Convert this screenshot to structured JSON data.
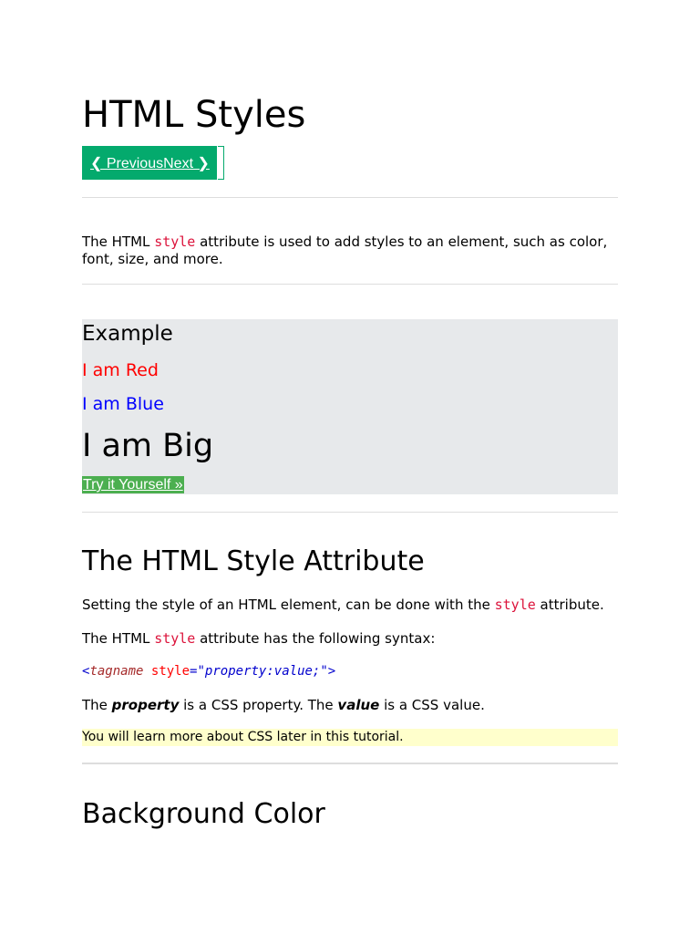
{
  "page": {
    "title": "HTML Styles"
  },
  "nav": {
    "previous_label": "❮ Previous",
    "next_label": "Next ❯"
  },
  "intro": {
    "before": "The HTML ",
    "keyword": "style",
    "after": " attribute is used to add styles to an element, such as color, font, size, and more."
  },
  "example": {
    "title": "Example",
    "red_text": "I am Red",
    "blue_text": "I am Blue",
    "big_text": "I am Big",
    "try_button": "Try it Yourself »",
    "colors": {
      "background": "#e7e9eb",
      "red": "#ff0000",
      "blue": "#0000ff",
      "button": "#4CAF50"
    }
  },
  "style_attribute": {
    "heading": "The HTML Style Attribute",
    "p1_before": "Setting the style of an HTML element, can be done with the ",
    "p1_keyword": "style",
    "p1_after": " attribute.",
    "p2_before": "The HTML ",
    "p2_keyword": "style",
    "p2_after": " attribute has the following syntax:",
    "syntax": {
      "open": "<",
      "tag": "tagname",
      "space": " ",
      "attr": "style",
      "equals": "=",
      "quote_open": "\"",
      "value": "property:value;",
      "quote_close": "\"",
      "close": ">"
    },
    "p3_before": "The ",
    "p3_term1": "property",
    "p3_middle": " is a CSS property. The ",
    "p3_term2": "value",
    "p3_after": " is a CSS value.",
    "note": "You will learn more about CSS later in this tutorial."
  },
  "background_color": {
    "heading": "Background Color"
  },
  "colors": {
    "accent_green": "#04AA6D",
    "keyword_red": "#dc143c",
    "note_yellow": "#ffffcc",
    "separator": "#dddddd"
  }
}
